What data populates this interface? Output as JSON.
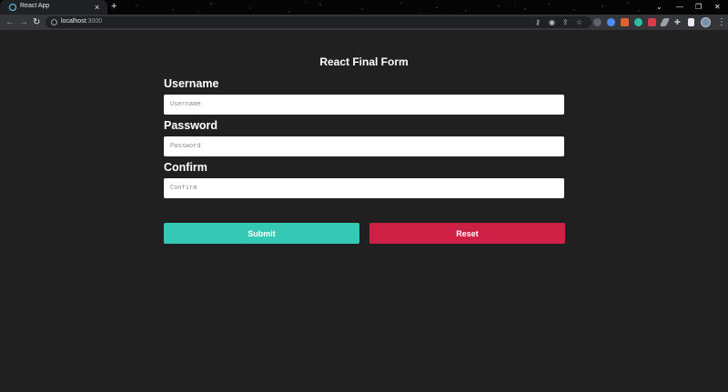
{
  "browser": {
    "tab_title": "React App",
    "close_glyph": "×",
    "new_tab_glyph": "+",
    "url_host": "localhost",
    "url_port": ":3000",
    "window_controls": [
      "⌄",
      "—",
      "❐",
      "✕"
    ]
  },
  "form": {
    "title": "React Final Form",
    "fields": [
      {
        "label": "Username",
        "placeholder": "Username",
        "value": ""
      },
      {
        "label": "Password",
        "placeholder": "Password",
        "value": ""
      },
      {
        "label": "Confirm",
        "placeholder": "Confirm",
        "value": ""
      }
    ],
    "submit_label": "Submit",
    "reset_label": "Reset"
  },
  "colors": {
    "background": "#202020",
    "submit": "#35c9b5",
    "reset": "#cd2044"
  }
}
